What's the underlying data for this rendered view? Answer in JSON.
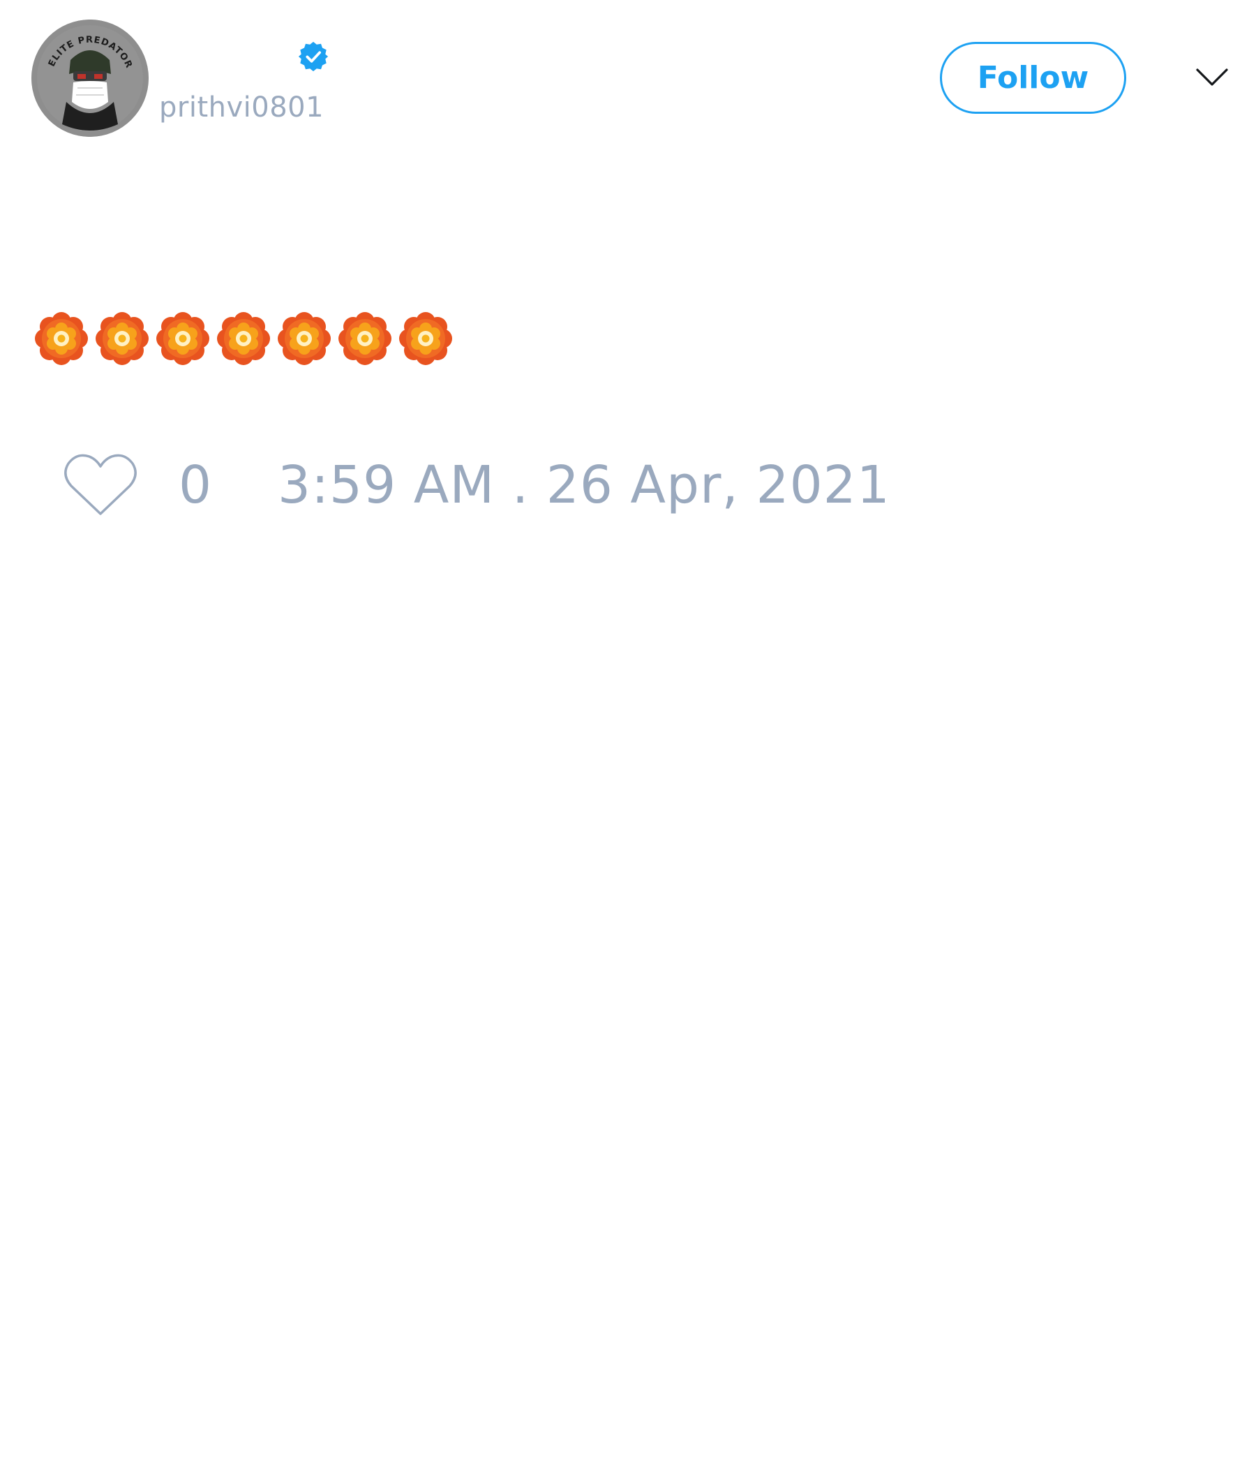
{
  "author": {
    "display_name": "",
    "username": "prithvi0801",
    "verified": true,
    "avatar": {
      "icon": "avatar-image",
      "badge_text": "ELITE PREDATORS"
    }
  },
  "header": {
    "follow_label": "Follow",
    "menu_icon": "chevron-down-icon"
  },
  "tweet": {
    "text": "🏵️🏵️🏵️🏵️🏵️🏵️🏵️",
    "emoji": [
      "rosette-icon",
      "rosette-icon",
      "rosette-icon",
      "rosette-icon",
      "rosette-icon",
      "rosette-icon",
      "rosette-icon"
    ]
  },
  "actions": {
    "like_icon": "heart-icon",
    "like_count": "0",
    "timestamp": "3:59 AM . 26 Apr, 2021"
  },
  "colors": {
    "accent": "#1da1f2",
    "muted_text": "#9aa9be",
    "flower_outer": "#e8531f",
    "flower_inner": "#f7a21b",
    "flower_center": "#fff1c4"
  }
}
